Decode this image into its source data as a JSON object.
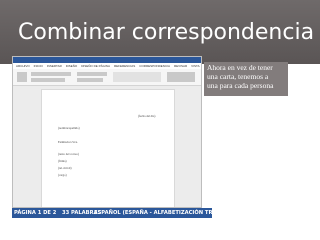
{
  "slide": {
    "title": "Combinar correspondencia",
    "note": [
      "Ahora en vez de tener",
      "una carta, tenemos a",
      "una para cada persona"
    ]
  },
  "document": {
    "date_line": "(fecha del día)",
    "lines": [
      "(nombre/apellido)",
      "Estimado/a Sr/a.",
      "(texto del correo)",
      "(firma)",
      "(tel. móvil)",
      "(cargo)"
    ]
  },
  "ribbon_tabs": [
    "ARCHIVO",
    "INICIO",
    "INSERTAR",
    "DISEÑO",
    "DISEÑO DE PÁGINA",
    "REFERENCIAS",
    "CORRESPONDENCIA",
    "REVISAR",
    "VISTA"
  ],
  "status_bar": {
    "page": "PÁGINA 1 DE 2",
    "words": "33 PALABRAS",
    "language": "ESPAÑOL (ESPAÑA - ALFABETIZACIÓN TRADICIONAL)"
  },
  "colors": {
    "title_band": "#6f6a6a",
    "word_accent": "#2b579a",
    "note_bg": "#827c7c"
  }
}
